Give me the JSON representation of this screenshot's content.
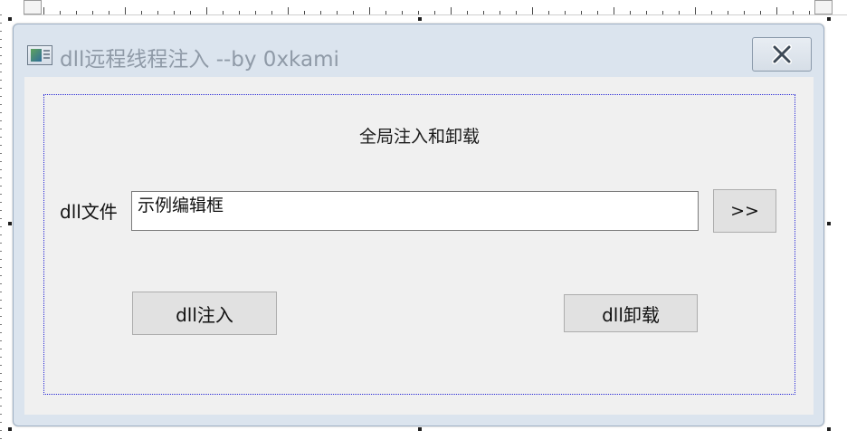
{
  "window": {
    "title": "dll远程线程注入 --by 0xkami",
    "close_label": "close"
  },
  "group": {
    "title": "全局注入和卸载"
  },
  "form": {
    "dll_file_label": "dll文件",
    "path_value": "示例编辑框",
    "browse_label": ">>"
  },
  "actions": {
    "inject_label": "dll注入",
    "unload_label": "dll卸载"
  },
  "colors": {
    "window_frame": "#dbe4ee",
    "client_bg": "#f0f0f0",
    "group_border": "#2a2ad6",
    "title_text": "#8f9aa7",
    "button_bg": "#e1e1e1"
  },
  "icons": {
    "app": "app-icon",
    "close": "close-icon"
  }
}
